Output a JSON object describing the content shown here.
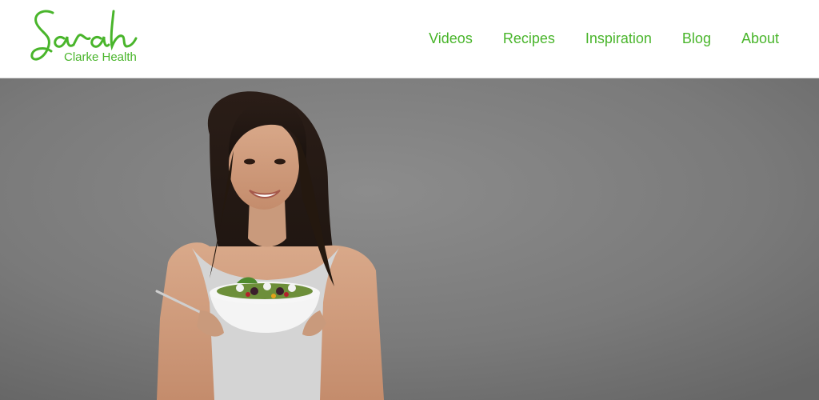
{
  "brand": {
    "script_name": "Sarah",
    "subtitle": "Clarke Health",
    "color": "#49b52b"
  },
  "nav": {
    "items": [
      {
        "label": "Videos"
      },
      {
        "label": "Recipes"
      },
      {
        "label": "Inspiration"
      },
      {
        "label": "Blog"
      },
      {
        "label": "About"
      }
    ]
  },
  "hero": {
    "image_description": "hero-photo",
    "background_color": "#7b7b7b"
  }
}
